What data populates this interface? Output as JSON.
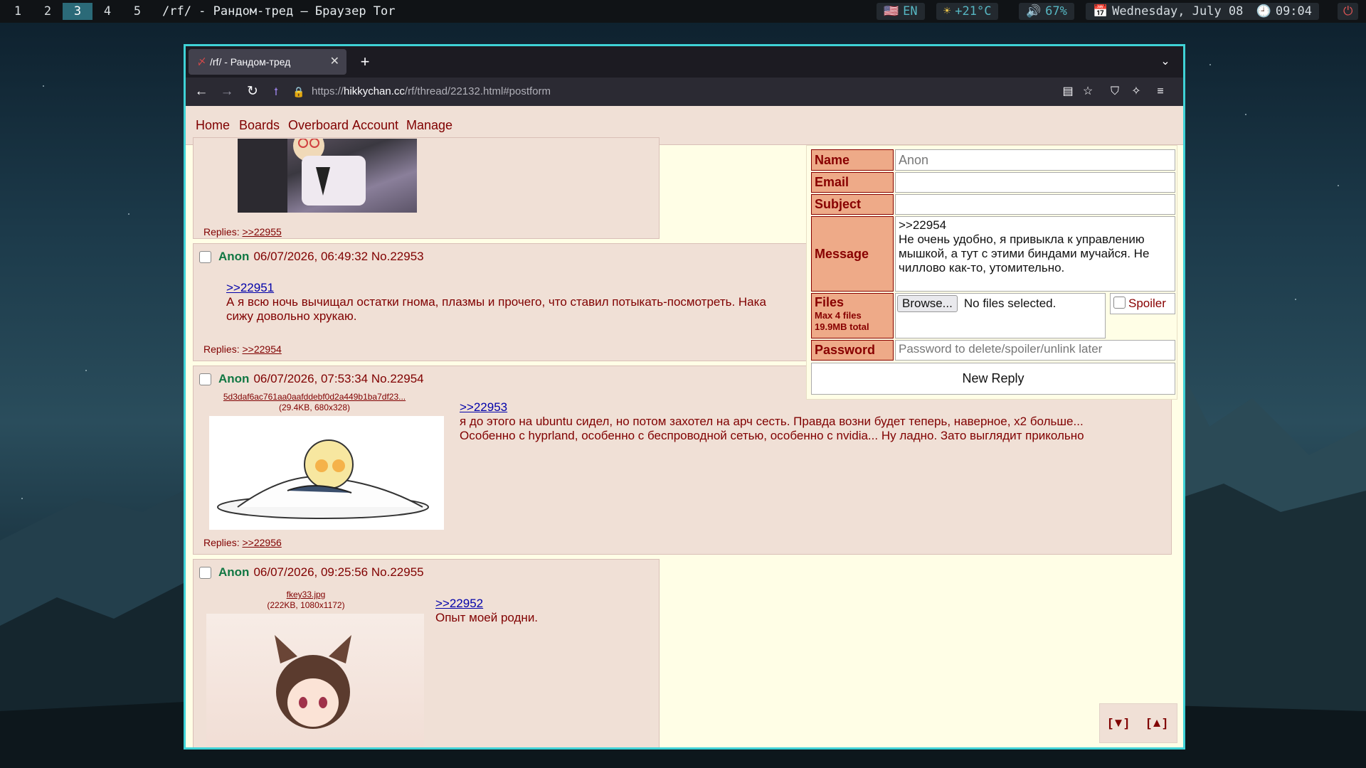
{
  "taskbar": {
    "workspaces": [
      "1",
      "2",
      "3",
      "4",
      "5"
    ],
    "active_workspace": "3",
    "window_title": "/rf/ - Рандом-тред — Браузер Tor",
    "language_flag": "🇺🇸",
    "language": "EN",
    "weather_icon": "sun-icon",
    "weather": "+21°C",
    "volume_icon": "speaker-icon",
    "volume": "67%",
    "date": "Wednesday, July 08",
    "time": "09:04",
    "power_icon": "power-icon"
  },
  "browser": {
    "tab_title": "/rf/ - Рандом-тред",
    "url_prefix": "https://",
    "url_host": "hikkychan.cc",
    "url_path": "/rf/thread/22132.html#postform"
  },
  "site_nav": [
    "Home",
    "Boards",
    "Overboard",
    "Account",
    "Manage"
  ],
  "posts": [
    {
      "replies_label": "Replies:",
      "replies": ">>22955"
    },
    {
      "name": "Anon",
      "date": "06/07/2026, 06:49:32",
      "number": "No.22953",
      "quote": ">>22951",
      "text": "А я всю ночь вычищал остатки гнома, плазмы и прочего, что ставил потыкать-посмотреть. Нака",
      "text2": "сижу довольно хрукаю.",
      "replies_label": "Replies:",
      "replies": ">>22954"
    },
    {
      "name": "Anon",
      "date": "06/07/2026, 07:53:34",
      "number": "No.22954",
      "file_name": "5d3daf6ac761aa0aafddebf0d2a449b1ba7df23...",
      "file_meta": "(29.4KB, 680x328)",
      "quote": ">>22953",
      "text": "я до этого на ubuntu сидел, но потом захотел на арч сесть. Правда возни будет теперь, наверное, x2 больше...",
      "text2": "Особенно с hyprland, особенно с беспроводной сетью, особенно с nvidia... Ну ладно. Зато выглядит прикольно",
      "replies_label": "Replies:",
      "replies": ">>22956"
    },
    {
      "name": "Anon",
      "date": "06/07/2026, 09:25:56",
      "number": "No.22955",
      "file_name": "fkey33.jpg",
      "file_meta": "(222KB, 1080x1172)",
      "quote": ">>22952",
      "text": "Опыт моей родни."
    }
  ],
  "form": {
    "name_label": "Name",
    "name_placeholder": "Anon",
    "email_label": "Email",
    "subject_label": "Subject",
    "message_label": "Message",
    "message_line1": ">>22954",
    "message_line2": "Не очень удобно, я привыкла к управлению",
    "message_line3": "мышкой, а тут с этими биндами мучайся. Не",
    "message_line4": "чиллово как-то, утомительно.",
    "files_label": "Files",
    "files_max": "Max 4 files",
    "files_total": "19.9MB total",
    "browse_label": "Browse...",
    "no_files": "No files selected.",
    "spoiler_label": "Spoiler",
    "password_label": "Password",
    "password_placeholder": "Password to delete/spoiler/unlink later",
    "submit_label": "New Reply"
  },
  "scroll_nav": {
    "down": "[▼]",
    "up": "[▲]"
  }
}
